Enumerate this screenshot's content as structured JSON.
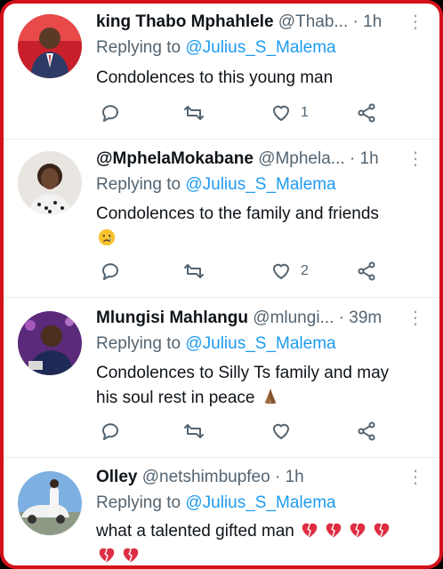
{
  "reply_prefix": "Replying to",
  "tweets": [
    {
      "name": "king Thabo Mphahlele",
      "handle": "@Thab...",
      "time": "· 1h",
      "reply_to": "@Julius_S_Malema",
      "text_lines": [
        "Condolences to this young man"
      ],
      "emoji_line": "",
      "likes": "1",
      "avatar_icon": "person-suit-red-background-avatar"
    },
    {
      "name": "@MphelaMokabane",
      "handle": "@Mphela...",
      "time": "· 1h",
      "reply_to": "@Julius_S_Malema",
      "text_lines": [
        "Condolences to the family and friends"
      ],
      "emoji_line": "crying-face-emoji",
      "likes": "2",
      "avatar_icon": "woman-portrait-avatar"
    },
    {
      "name": "Mlungisi Mahlangu",
      "handle": "@mlungi...",
      "time": "· 39m",
      "reply_to": "@Julius_S_Malema",
      "text_lines": [
        "Condolences to Silly Ts family and may",
        "his soul rest in peace"
      ],
      "emoji_line": "folded-hands-emoji",
      "likes": "",
      "avatar_icon": "man-purple-background-avatar"
    },
    {
      "name": "Olley",
      "handle": "@netshimbupfeo",
      "time": "· 1h",
      "reply_to": "@Julius_S_Malema",
      "text_lines": [
        "what a talented gifted man"
      ],
      "emoji_line": "broken-heart-emoji",
      "likes": "",
      "avatar_icon": "person-with-car-avatar"
    }
  ],
  "colors": {
    "frame": "#d4101a",
    "mention": "#1d9bf0",
    "secondary_text": "#536471",
    "primary_text": "#0f1419"
  }
}
